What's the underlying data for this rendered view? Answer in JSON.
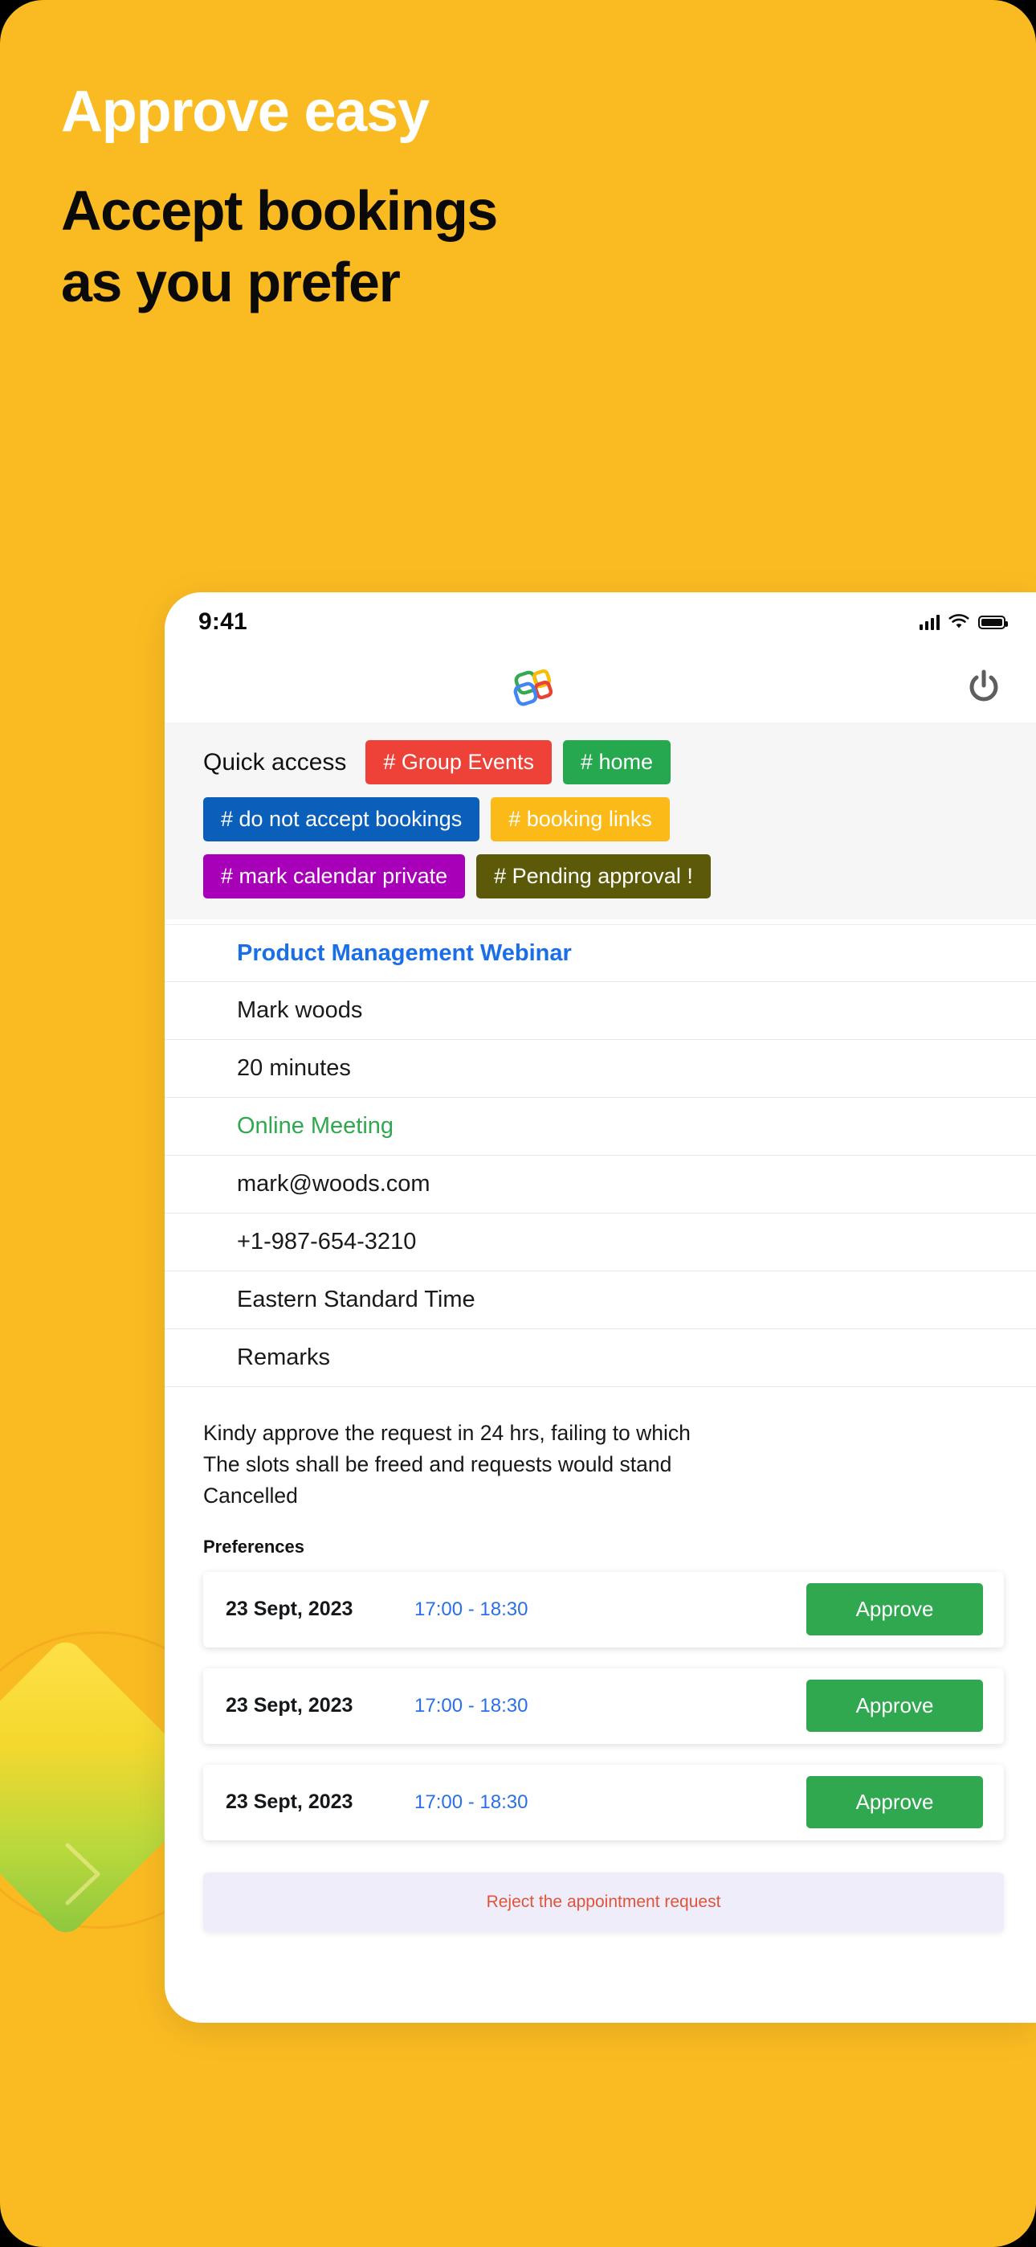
{
  "poster": {
    "background_color": "#FABB22",
    "headline_line1": "Approve easy",
    "headline_line2": "Accept bookings",
    "headline_line3": "as you prefer",
    "headline_line1_color": "#FFFFFF",
    "headline_body_color": "#0A0A0A"
  },
  "phone": {
    "status_bar": {
      "time": "9:41",
      "signal_icon": "cellular-signal-icon",
      "wifi_icon": "wifi-icon",
      "battery_icon": "battery-full-icon"
    },
    "app_bar": {
      "logo_icon": "app-logo-icon",
      "power_icon": "power-icon"
    },
    "quick_access": {
      "label": "Quick access",
      "chips": [
        {
          "label": "# Group Events",
          "color": "#EE4238"
        },
        {
          "label": "# home",
          "color": "#25A84E"
        },
        {
          "label": "# do not accept bookings",
          "color": "#0A5FBA"
        },
        {
          "label": "# booking links",
          "color": "#FBBA17"
        },
        {
          "label": "# mark calendar private",
          "color": "#A800B8"
        },
        {
          "label": "# Pending approval !",
          "color": "#5C5A09"
        }
      ]
    },
    "details": [
      {
        "text": "Product Management Webinar",
        "style": "title"
      },
      {
        "text": "Mark woods",
        "style": "plain"
      },
      {
        "text": "20 minutes",
        "style": "plain"
      },
      {
        "text": "Online Meeting",
        "style": "mode"
      },
      {
        "text": "mark@woods.com",
        "style": "plain"
      },
      {
        "text": "+1-987-654-3210",
        "style": "plain"
      },
      {
        "text": "Eastern Standard Time",
        "style": "plain"
      },
      {
        "text": "Remarks",
        "style": "plain"
      }
    ],
    "note": {
      "line1": "Kindy approve the request in 24 hrs, failing to which",
      "line2": "The slots shall be freed and requests would stand",
      "line3": "Cancelled"
    },
    "preferences_label": "Preferences",
    "preferences": [
      {
        "date": "23 Sept, 2023",
        "time": "17:00 - 18:30",
        "action": "Approve"
      },
      {
        "date": "23 Sept, 2023",
        "time": "17:00 - 18:30",
        "action": "Approve"
      },
      {
        "date": "23 Sept, 2023",
        "time": "17:00 - 18:30",
        "action": "Approve"
      }
    ],
    "reject_label": "Reject the appointment request",
    "colors": {
      "title_blue": "#1A6FE8",
      "mode_green": "#2FA84F",
      "time_blue": "#2B6FE8",
      "approve_green": "#2FA84F",
      "reject_bg": "#EFEDFA",
      "reject_text": "#E0543A",
      "panel_gray": "#F6F6F6"
    }
  }
}
